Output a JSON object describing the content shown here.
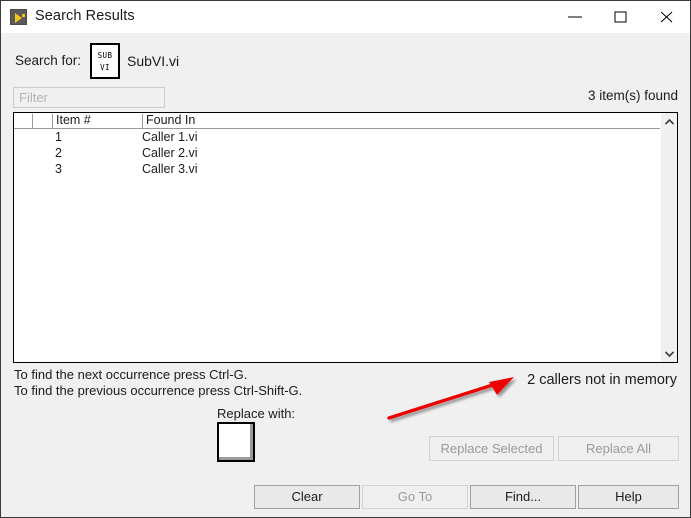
{
  "window": {
    "title": "Search Results",
    "app_icon": "labview-icon",
    "controls": {
      "minimize": "minimize-icon",
      "maximize": "maximize-icon",
      "close": "close-icon"
    }
  },
  "search": {
    "label": "Search for:",
    "target_icon_line1": "SUB",
    "target_icon_line2": "VI",
    "target_name": "SubVI.vi"
  },
  "filter": {
    "placeholder": "Filter",
    "value": ""
  },
  "status": {
    "items_found": "3 item(s) found"
  },
  "list": {
    "columns": [
      "",
      "",
      "Item #",
      "Found In"
    ],
    "rows": [
      {
        "num": "1",
        "found_in": "Caller 1.vi"
      },
      {
        "num": "2",
        "found_in": "Caller 2.vi"
      },
      {
        "num": "3",
        "found_in": "Caller 3.vi"
      }
    ],
    "scrollbar": {
      "up_icon": "chevron-up-icon",
      "down_icon": "chevron-down-icon"
    }
  },
  "hints": {
    "line1": "To find the next occurrence press Ctrl-G.",
    "line2": "To find the previous occurrence press Ctrl-Shift-G."
  },
  "annotation": {
    "text": "2 callers not in memory",
    "arrow_color": "#ee0000"
  },
  "replace": {
    "label": "Replace with:",
    "swatch_color": "#ffffff",
    "replace_selected_label": "Replace Selected",
    "replace_all_label": "Replace All"
  },
  "footer": {
    "clear_label": "Clear",
    "goto_label": "Go To",
    "find_label": "Find...",
    "help_label": "Help"
  }
}
